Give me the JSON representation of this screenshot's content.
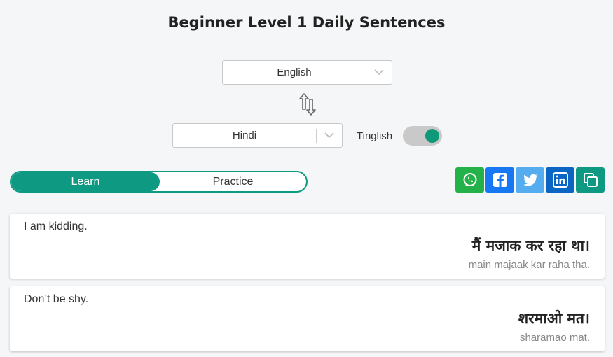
{
  "title": "Beginner Level 1 Daily Sentences",
  "source_language": "English",
  "target_language": "Hindi",
  "tinglish": {
    "label": "Tinglish",
    "enabled": true
  },
  "mode": {
    "learn": "Learn",
    "practice": "Practice",
    "active": "Learn"
  },
  "colors": {
    "accent": "#0e9a82",
    "whatsapp": "#25b14a",
    "facebook": "#1877f2",
    "twitter": "#55acee",
    "linkedin": "#0a66c2",
    "copy": "#0e9a82"
  },
  "share_icons": [
    "whatsapp-icon",
    "facebook-icon",
    "twitter-icon",
    "linkedin-icon",
    "copy-icon"
  ],
  "sentences": [
    {
      "english": "I am kidding.",
      "hindi": "मैं मजाक कर रहा था।",
      "translit": "main majaak kar raha tha."
    },
    {
      "english": "Don’t be shy.",
      "hindi": "शरमाओ मत।",
      "translit": "sharamao mat."
    }
  ]
}
